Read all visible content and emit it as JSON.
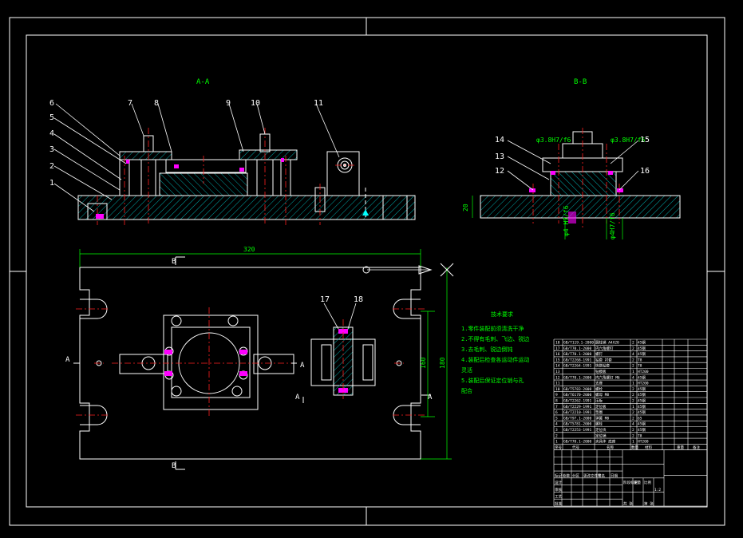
{
  "views": {
    "section_aa": "A-A",
    "section_bb": "B-B"
  },
  "balloons_aa": [
    "1",
    "2",
    "3",
    "4",
    "5",
    "6",
    "7",
    "8",
    "9",
    "10",
    "11"
  ],
  "balloons_bb": [
    "12",
    "13",
    "14",
    "15",
    "16"
  ],
  "balloons_plan": [
    "17",
    "18"
  ],
  "fits": {
    "left_top": "φ3.8H7/f6",
    "right_top": "φ3.8H7/f6",
    "bottom_left": "φ4 H7/f6",
    "bottom_right": "φ4H7/f6"
  },
  "dims": {
    "length": "320",
    "width_inner": "160",
    "width_outer": "180",
    "height": "20"
  },
  "markers": {
    "b_top": "B",
    "b_bottom": "B",
    "a_left": "A",
    "a_mid": "A",
    "a_right": "A",
    "a_bottom": "A"
  },
  "notes": {
    "title": "技术要求",
    "lines": [
      "1.零件装配前须清洗干净",
      "2.不得有毛刺、飞边、锐边",
      "3.去毛刺、锐边倒钝",
      "4.装配后检查各运动件运动",
      "灵活",
      "5.装配后保证定位销与孔",
      "配合"
    ]
  },
  "colors": {
    "line": "#ffffff",
    "hatch": "#00b3b3",
    "dim": "#00ff00",
    "center": "#ff2020",
    "accent": "#ff00ff",
    "fill_cyan": "#00ffff"
  },
  "bom": {
    "rows": [
      {
        "no": "18",
        "code": "GB/T119.1-2000",
        "name": "圆柱销 A4X20",
        "qty": "2",
        "mat": "45钢"
      },
      {
        "no": "17",
        "code": "GB/T70.1-2000",
        "name": "内六角螺钉",
        "qty": "2",
        "mat": "45钢"
      },
      {
        "no": "16",
        "code": "GB/T70.1-2000",
        "name": "螺钉",
        "qty": "4",
        "mat": "45钢"
      },
      {
        "no": "15",
        "code": "GB/T2268-1991",
        "name": "钻套 衬套",
        "qty": "2",
        "mat": "T8"
      },
      {
        "no": "14",
        "code": "GB/T2264-1991",
        "name": "快换钻套",
        "qty": "2",
        "mat": "T8"
      },
      {
        "no": "13",
        "code": "",
        "name": "钻模板",
        "qty": "1",
        "mat": "HT200"
      },
      {
        "no": "12",
        "code": "GB/T70.1-2000",
        "name": "内六角螺钉 M6",
        "qty": "4",
        "mat": "45钢"
      },
      {
        "no": "11",
        "code": "",
        "name": "支座",
        "qty": "1",
        "mat": "HT200"
      },
      {
        "no": "10",
        "code": "GB/T5783-2000",
        "name": "螺栓",
        "qty": "2",
        "mat": "45钢"
      },
      {
        "no": "9",
        "code": "GB/T6170-2000",
        "name": "螺母 M8",
        "qty": "2",
        "mat": "45钢"
      },
      {
        "no": "8",
        "code": "GB/T2262-1991",
        "name": "压板",
        "qty": "2",
        "mat": "45钢"
      },
      {
        "no": "7",
        "code": "GB/T2229-1991",
        "name": "定位板",
        "qty": "1",
        "mat": "45钢"
      },
      {
        "no": "6",
        "code": "GB/T2210-1991",
        "name": "垫圈",
        "qty": "2",
        "mat": "45钢"
      },
      {
        "no": "5",
        "code": "GB/T97.1-2000",
        "name": "弹簧 M8",
        "qty": "2",
        "mat": "65"
      },
      {
        "no": "4",
        "code": "GB/T5781-2000",
        "name": "螺栓",
        "qty": "4",
        "mat": "45钢"
      },
      {
        "no": "3",
        "code": "GB/T2253-1991",
        "name": "定位块",
        "qty": "2",
        "mat": "45钢"
      },
      {
        "no": "2",
        "code": "",
        "name": "定位销",
        "qty": "2",
        "mat": "T8"
      },
      {
        "no": "1",
        "code": "GB/T70.1-2000",
        "name": "夹具体 底座",
        "qty": "1",
        "mat": "HT200"
      }
    ],
    "header": [
      "序号",
      "代号",
      "名称",
      "数量",
      "材料",
      "重量",
      "备注"
    ],
    "title_cells": [
      "标记",
      "处数",
      "分区",
      "更改文件号",
      "签名",
      "日期",
      "设计",
      "审核",
      "工艺",
      "批准",
      "阶段标记",
      "重量",
      "比例",
      "共 张",
      "第 张",
      "1:2"
    ]
  }
}
